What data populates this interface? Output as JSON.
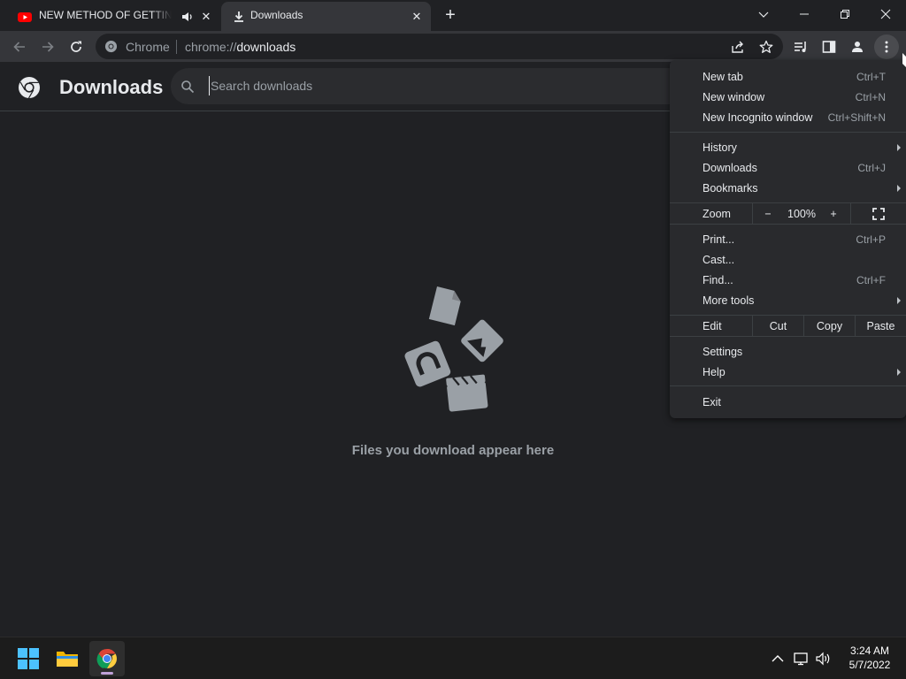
{
  "tabs": [
    {
      "title": "NEW METHOD OF GETTING",
      "state": "inactive",
      "favicon": "youtube-icon",
      "audio": "speaker-icon"
    },
    {
      "title": "Downloads",
      "state": "active",
      "favicon": "download-icon"
    }
  ],
  "toolbar": {
    "site_name": "Chrome",
    "url_scheme": "chrome://",
    "url_host": "downloads"
  },
  "page": {
    "title": "Downloads",
    "search_placeholder": "Search downloads",
    "empty_message": "Files you download appear here"
  },
  "menu": {
    "items_group1": [
      {
        "label": "New tab",
        "shortcut": "Ctrl+T"
      },
      {
        "label": "New window",
        "shortcut": "Ctrl+N"
      },
      {
        "label": "New Incognito window",
        "shortcut": "Ctrl+Shift+N"
      }
    ],
    "items_group2": [
      {
        "label": "History",
        "shortcut": "",
        "submenu": true
      },
      {
        "label": "Downloads",
        "shortcut": "Ctrl+J"
      },
      {
        "label": "Bookmarks",
        "shortcut": "",
        "submenu": true
      }
    ],
    "zoom": {
      "label": "Zoom",
      "minus": "−",
      "value": "100%",
      "plus": "+"
    },
    "items_group3": [
      {
        "label": "Print...",
        "shortcut": "Ctrl+P"
      },
      {
        "label": "Cast...",
        "shortcut": ""
      },
      {
        "label": "Find...",
        "shortcut": "Ctrl+F"
      },
      {
        "label": "More tools",
        "shortcut": "",
        "submenu": true
      }
    ],
    "edit": {
      "label": "Edit",
      "cut": "Cut",
      "copy": "Copy",
      "paste": "Paste"
    },
    "items_group4": [
      {
        "label": "Settings",
        "shortcut": ""
      },
      {
        "label": "Help",
        "shortcut": "",
        "submenu": true
      }
    ],
    "exit_label": "Exit"
  },
  "taskbar": {
    "time": "3:24 AM",
    "date": "5/7/2022"
  },
  "colors": {
    "page_bg": "#202124",
    "toolbar_bg": "#35363a",
    "menu_bg": "#292a2d",
    "text_primary": "#e8eaed",
    "text_secondary": "#9aa0a6",
    "youtube_red": "#ff0000",
    "taskbar_bg": "#1c1c1c"
  }
}
